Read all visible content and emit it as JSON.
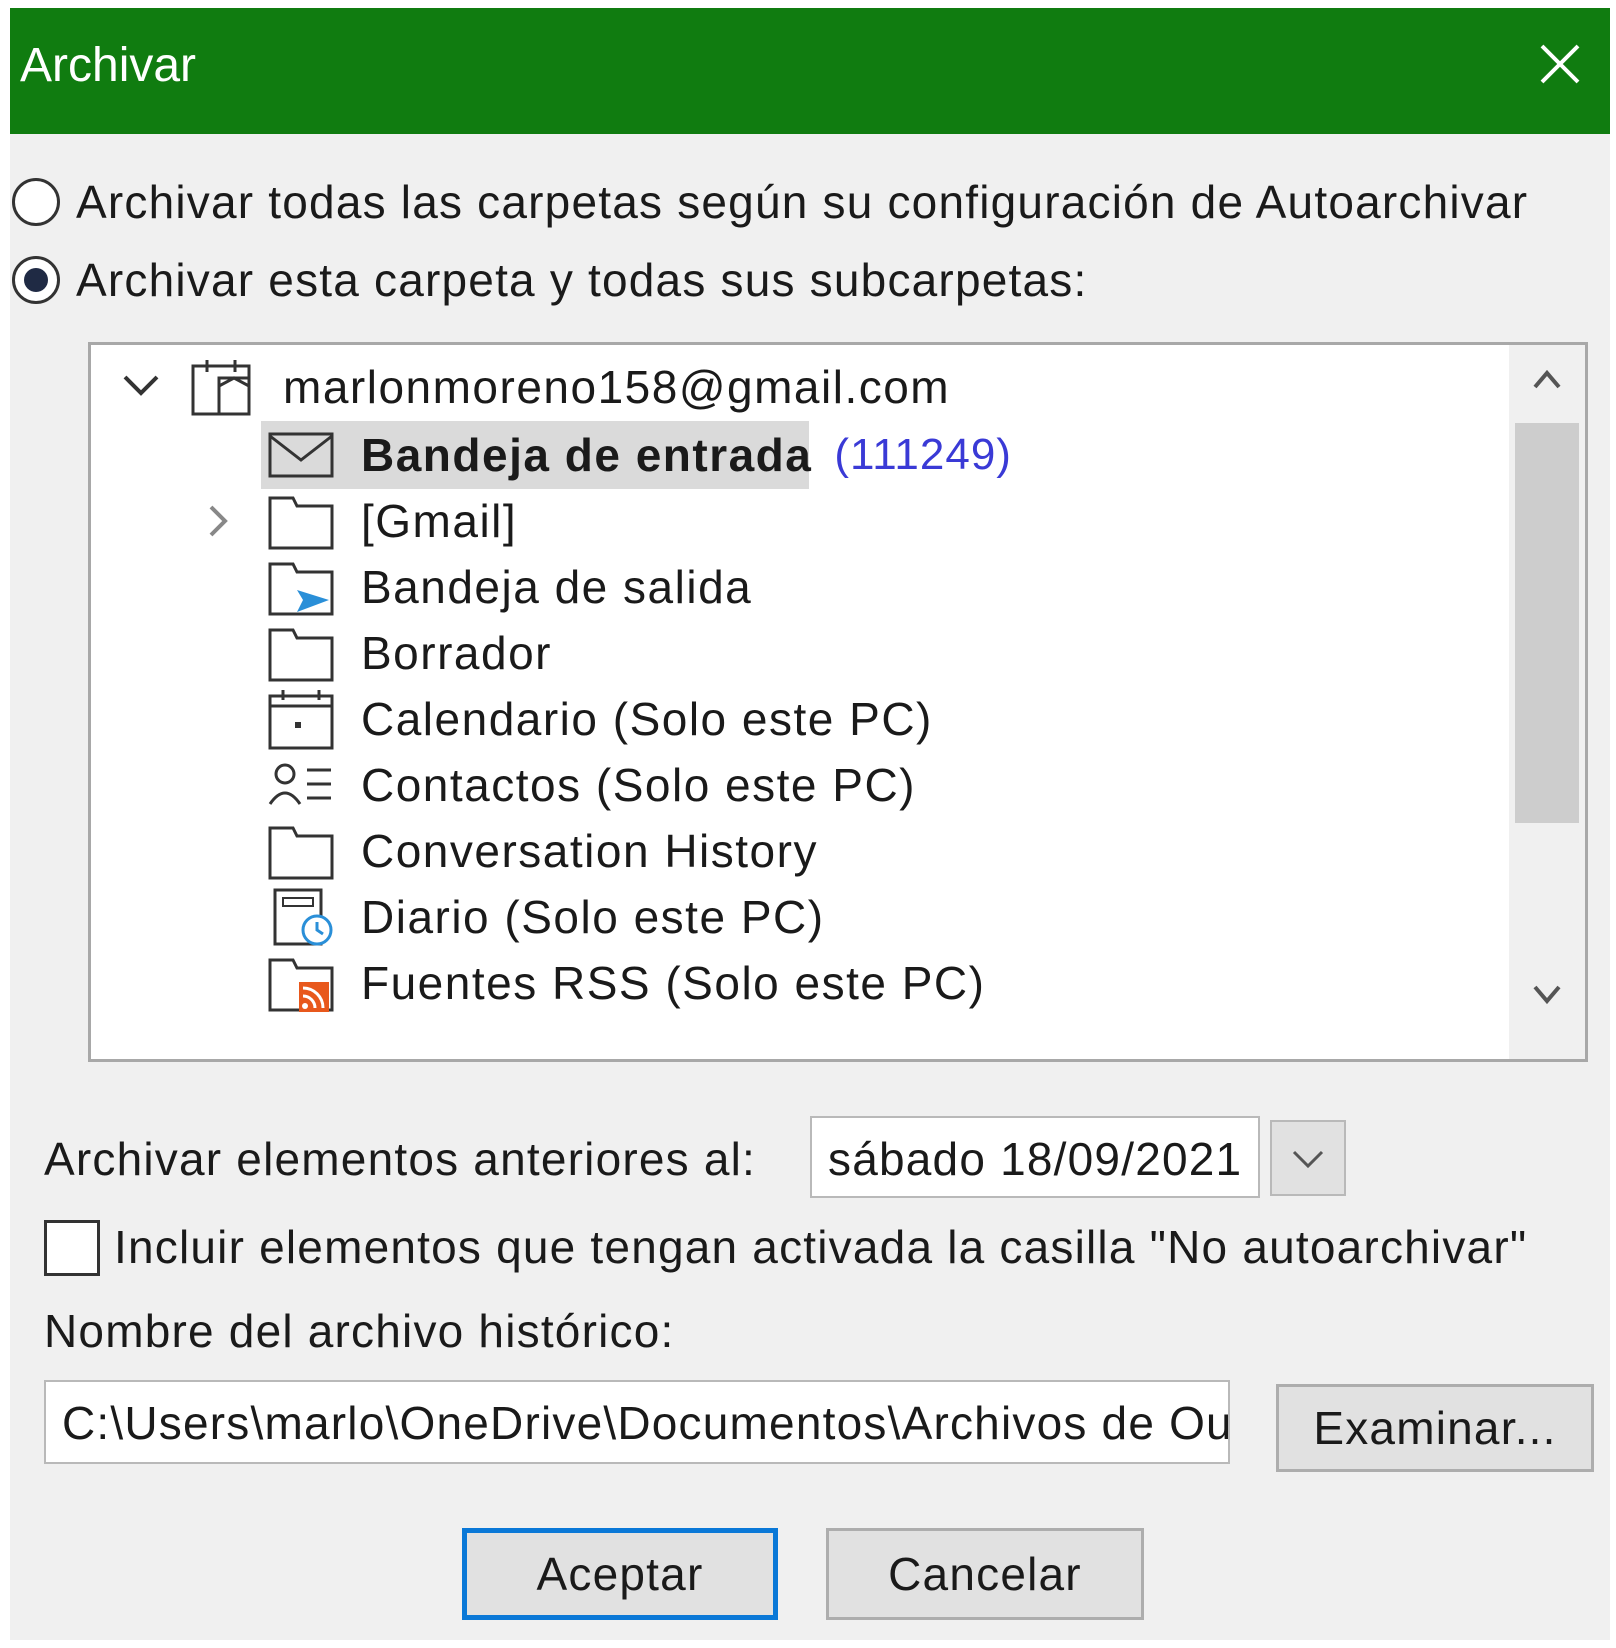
{
  "window": {
    "title": "Archivar"
  },
  "options": {
    "all_folders_label": "Archivar todas las carpetas según su configuración de Autoarchivar",
    "this_folder_label": "Archivar esta carpeta y todas sus subcarpetas:",
    "selected": "this_folder"
  },
  "tree": {
    "account": "marlonmoreno158@gmail.com",
    "items": [
      {
        "label": "Bandeja de entrada",
        "count": "(111249)",
        "icon": "mail-icon",
        "selected": true
      },
      {
        "label": "[Gmail]",
        "icon": "folder-icon",
        "expandable": true
      },
      {
        "label": "Bandeja de salida",
        "icon": "outbox-icon"
      },
      {
        "label": "Borrador",
        "icon": "folder-icon"
      },
      {
        "label": "Calendario (Solo este PC)",
        "icon": "calendar-icon"
      },
      {
        "label": "Contactos (Solo este PC)",
        "icon": "contacts-icon"
      },
      {
        "label": "Conversation History",
        "icon": "folder-icon"
      },
      {
        "label": "Diario (Solo este PC)",
        "icon": "journal-icon"
      },
      {
        "label": "Fuentes RSS (Solo este PC)",
        "icon": "rss-folder-icon"
      }
    ]
  },
  "archive_date": {
    "label": "Archivar elementos anteriores al:",
    "value": "sábado 18/09/2021"
  },
  "include_no_autoarchive": {
    "label": "Incluir elementos que tengan activada la casilla \"No autoarchivar\"",
    "checked": false
  },
  "archive_file": {
    "label": "Nombre del archivo histórico:",
    "value": "C:\\Users\\marlo\\OneDrive\\Documentos\\Archivos de Outlook\\archive.pst",
    "browse_label": "Examinar..."
  },
  "buttons": {
    "ok": "Aceptar",
    "cancel": "Cancelar"
  },
  "colors": {
    "titlebar": "#107c10",
    "count": "#3a3ad6",
    "default_button_border": "#0a78d7"
  }
}
